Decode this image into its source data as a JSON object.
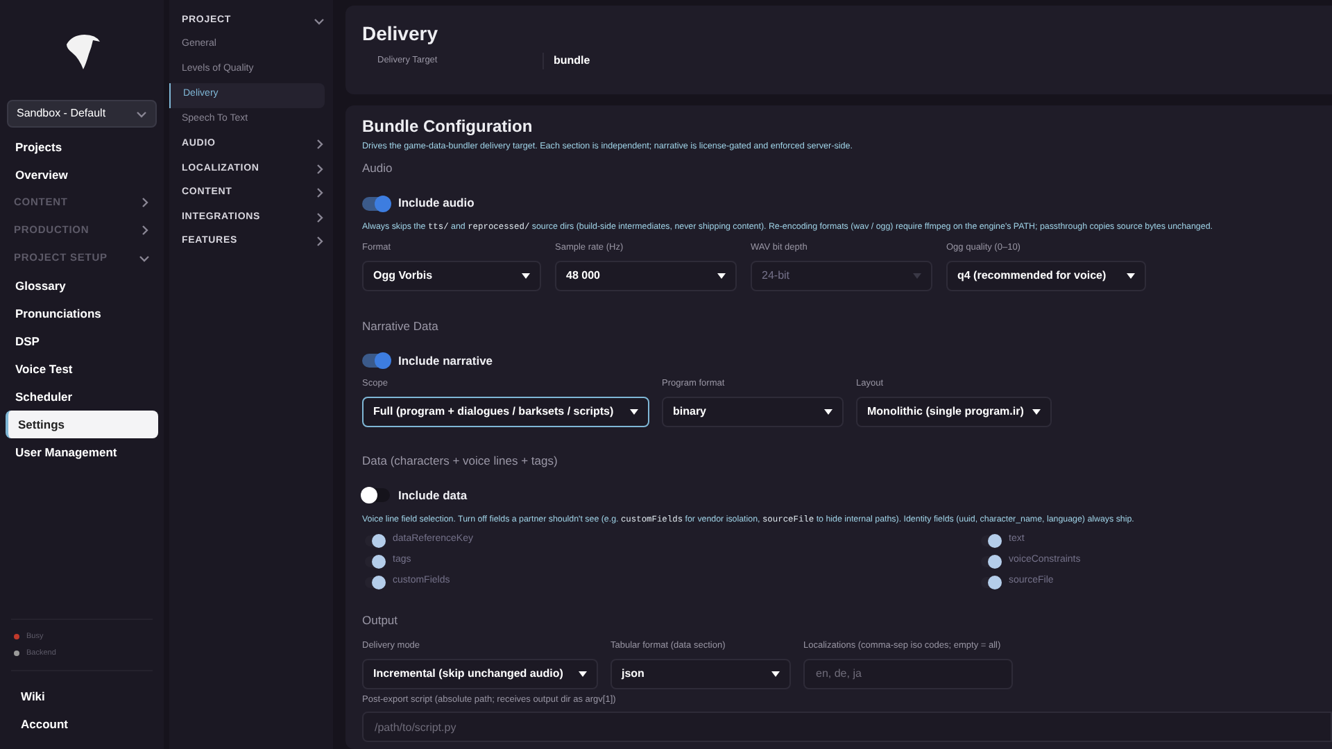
{
  "sidebar": {
    "workspace": "Sandbox - Default",
    "items": [
      {
        "kind": "link",
        "label": "Projects",
        "selected": false
      },
      {
        "kind": "link",
        "label": "Overview",
        "selected": false
      },
      {
        "kind": "group",
        "label": "CONTENT",
        "expanded": false
      },
      {
        "kind": "group",
        "label": "PRODUCTION",
        "expanded": false
      },
      {
        "kind": "group",
        "label": "PROJECT SETUP",
        "expanded": true
      },
      {
        "kind": "link",
        "label": "Glossary",
        "selected": false
      },
      {
        "kind": "link",
        "label": "Pronunciations",
        "selected": false
      },
      {
        "kind": "link",
        "label": "DSP",
        "selected": false
      },
      {
        "kind": "link",
        "label": "Voice Test",
        "selected": false
      },
      {
        "kind": "link",
        "label": "Scheduler",
        "selected": false
      },
      {
        "kind": "link",
        "label": "Settings",
        "selected": true
      },
      {
        "kind": "link",
        "label": "User Management",
        "selected": false
      }
    ],
    "status": [
      {
        "label": "Busy",
        "color": "#c0392b"
      },
      {
        "label": "Backend",
        "color": "#9a9a9a"
      }
    ],
    "footer": [
      "Wiki",
      "Account"
    ]
  },
  "settings_nav": [
    {
      "kind": "group",
      "label": "PROJECT",
      "expanded": true
    },
    {
      "kind": "item",
      "label": "General",
      "selected": false
    },
    {
      "kind": "item",
      "label": "Levels of Quality",
      "selected": false
    },
    {
      "kind": "item",
      "label": "Delivery",
      "selected": true
    },
    {
      "kind": "item",
      "label": "Speech To Text",
      "selected": false
    },
    {
      "kind": "group",
      "label": "AUDIO",
      "expanded": false
    },
    {
      "kind": "group",
      "label": "LOCALIZATION",
      "expanded": false
    },
    {
      "kind": "group",
      "label": "CONTENT",
      "expanded": false
    },
    {
      "kind": "group",
      "label": "INTEGRATIONS",
      "expanded": false
    },
    {
      "kind": "group",
      "label": "FEATURES",
      "expanded": false
    }
  ],
  "delivery": {
    "title": "Delivery",
    "target_label": "Delivery Target",
    "target_value": "bundle"
  },
  "bundle": {
    "title": "Bundle Configuration",
    "description": "Drives the game-data-bundler delivery target. Each section is independent; narrative is license-gated and enforced server-side.",
    "audio": {
      "heading": "Audio",
      "toggle": {
        "label": "Include audio",
        "on": true
      },
      "note": [
        {
          "text": "Always skips the ",
          "code": false
        },
        {
          "text": "tts/",
          "code": true
        },
        {
          "text": " and ",
          "code": false
        },
        {
          "text": "reprocessed/",
          "code": true
        },
        {
          "text": " source dirs (build-side intermediates, never shipping content). Re-encoding formats (wav / ogg) require ffmpeg on the engine's PATH; passthrough copies source bytes unchanged.",
          "code": false
        }
      ],
      "fields": [
        {
          "label": "Format",
          "value": "Ogg Vorbis",
          "disabled": false
        },
        {
          "label": "Sample rate (Hz)",
          "value": "48 000",
          "disabled": false
        },
        {
          "label": "WAV bit depth",
          "value": "24-bit",
          "disabled": true
        },
        {
          "label": "Ogg quality (0–10)",
          "value": "q4 (recommended for voice)",
          "disabled": false
        }
      ]
    },
    "narrative": {
      "heading": "Narrative Data",
      "toggle": {
        "label": "Include narrative",
        "on": true
      },
      "fields": [
        {
          "label": "Scope",
          "value": "Full (program + dialogues / barksets / scripts)",
          "focused": true
        },
        {
          "label": "Program format",
          "value": "binary",
          "focused": false
        },
        {
          "label": "Layout",
          "value": "Monolithic (single program.ir)",
          "focused": false
        }
      ]
    },
    "data": {
      "heading": "Data (characters + voice lines + tags)",
      "toggle": {
        "label": "Include data",
        "on": false
      },
      "note": [
        {
          "text": "Voice line field selection. Turn off fields a partner shouldn't see (e.g. ",
          "code": false
        },
        {
          "text": "customFields",
          "code": true
        },
        {
          "text": " for vendor isolation, ",
          "code": false
        },
        {
          "text": "sourceFile",
          "code": true
        },
        {
          "text": " to hide internal paths). Identity fields (uuid, character_name, language) always ship.",
          "code": false
        }
      ],
      "fields_left": [
        {
          "label": "dataReferenceKey",
          "on": true
        },
        {
          "label": "tags",
          "on": true
        },
        {
          "label": "customFields",
          "on": true
        }
      ],
      "fields_right": [
        {
          "label": "text",
          "on": true
        },
        {
          "label": "voiceConstraints",
          "on": true
        },
        {
          "label": "sourceFile",
          "on": true
        }
      ]
    },
    "output": {
      "heading": "Output",
      "fields": [
        {
          "kind": "select",
          "label": "Delivery mode",
          "value": "Incremental (skip unchanged audio)"
        },
        {
          "kind": "select",
          "label": "Tabular format (data section)",
          "value": "json"
        },
        {
          "kind": "input",
          "label": "Localizations (comma-sep iso codes; empty = all)",
          "placeholder": "en, de, ja"
        }
      ],
      "script": {
        "label": "Post-export script (absolute path; receives output dir as argv[1])",
        "placeholder": "/path/to/script.py"
      }
    }
  }
}
